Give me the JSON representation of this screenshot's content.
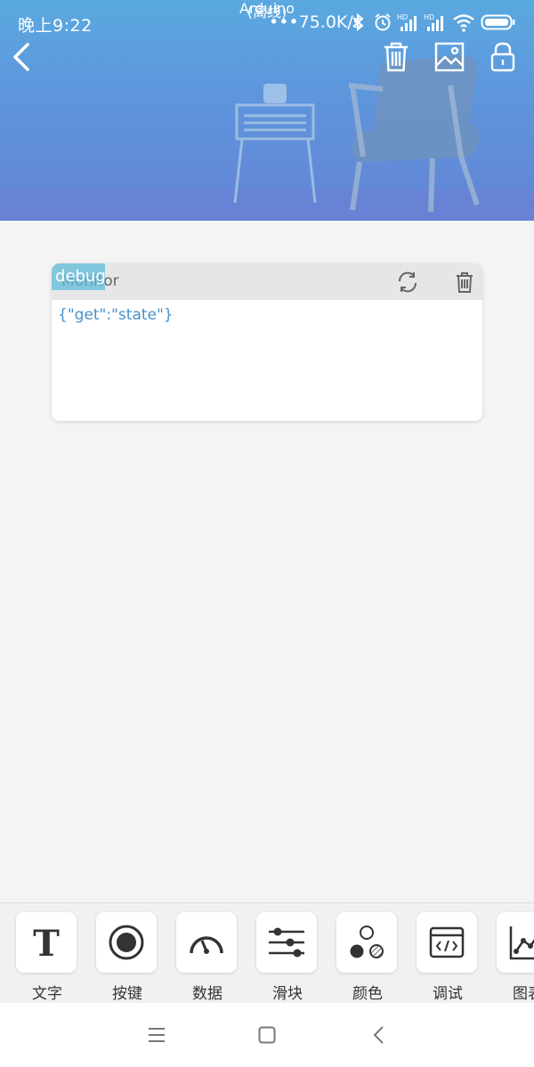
{
  "status_bar": {
    "time": "晚上9:22",
    "network_speed": "•••75.0K/s",
    "icons": [
      "bluetooth-icon",
      "alarm-icon",
      "signal-hd-icon",
      "signal-hd-icon",
      "wifi-icon",
      "battery-icon"
    ]
  },
  "header": {
    "title": "Arduino",
    "subtitle": "(离线)",
    "icons": [
      "back-icon",
      "trash-icon",
      "image-icon",
      "lock-icon"
    ]
  },
  "card": {
    "tag": "debug",
    "title": "Monitor",
    "content": "{\"get\":\"state\"}",
    "icons": [
      "refresh-icon",
      "trash-icon"
    ]
  },
  "toolbar": {
    "items": [
      {
        "label": "文字",
        "icon": "text-icon"
      },
      {
        "label": "按键",
        "icon": "button-icon"
      },
      {
        "label": "数据",
        "icon": "gauge-icon"
      },
      {
        "label": "滑块",
        "icon": "slider-icon"
      },
      {
        "label": "颜色",
        "icon": "color-icon"
      },
      {
        "label": "调试",
        "icon": "code-icon"
      },
      {
        "label": "图表",
        "icon": "chart-icon"
      }
    ]
  },
  "system_nav": {
    "icons": [
      "menu-icon",
      "home-icon",
      "back-icon"
    ]
  }
}
